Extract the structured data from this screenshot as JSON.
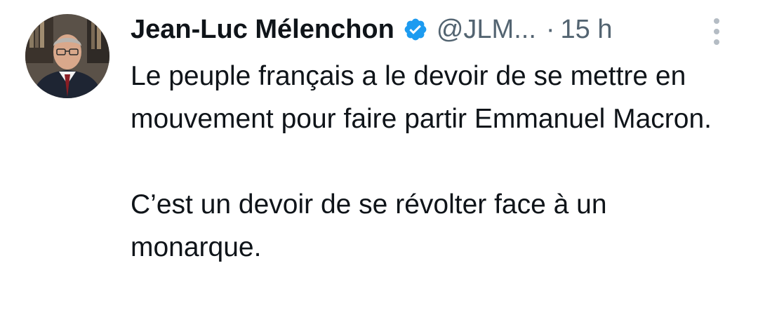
{
  "tweet": {
    "author": {
      "name": "Jean-Luc Mélenchon",
      "handle": "@JLM...",
      "verified_color": "#1d9bf0"
    },
    "separator": "·",
    "timestamp": "15 h",
    "more_icon": "vertical-ellipsis-icon",
    "paragraphs": [
      "Le peuple français a le devoir de se mettre en mouvement pour faire partir Emmanuel Macron.",
      "C’est un devoir de se révolter face à un monarque."
    ]
  }
}
